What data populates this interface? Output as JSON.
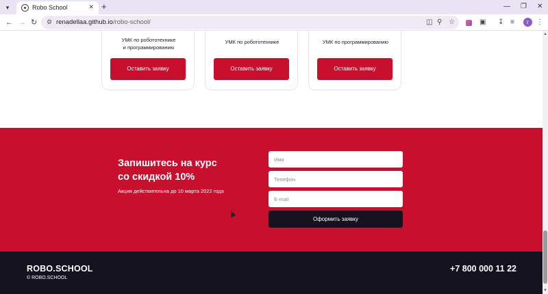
{
  "browser": {
    "tab_title": "Robo School",
    "url_host": "renadellaa.github.io",
    "url_path": "/robo-school/",
    "profile_initial": "г"
  },
  "cards": [
    {
      "description": "УМК по робототехнике\nи программированию",
      "button": "Оставить заявку"
    },
    {
      "description": "УМК по робототехнике",
      "button": "Оставить заявку"
    },
    {
      "description": "УМК по программированию",
      "button": "Оставить заявку"
    }
  ],
  "signup": {
    "title": "Запишитесь на курс\nсо скидкой 10%",
    "subtitle": "Акция действительна до 10 марта 2022 года",
    "name_placeholder": "Имя",
    "phone_placeholder": "Телефон",
    "email_placeholder": "E-mail",
    "submit_label": "Оформить заявку"
  },
  "footer": {
    "logo": "ROBO.SCHOOL",
    "copyright": "© ROBO.SCHOOL",
    "phone": "+7 800 000 11 22"
  },
  "colors": {
    "brand_red": "#c8102e",
    "dark": "#15121f"
  }
}
